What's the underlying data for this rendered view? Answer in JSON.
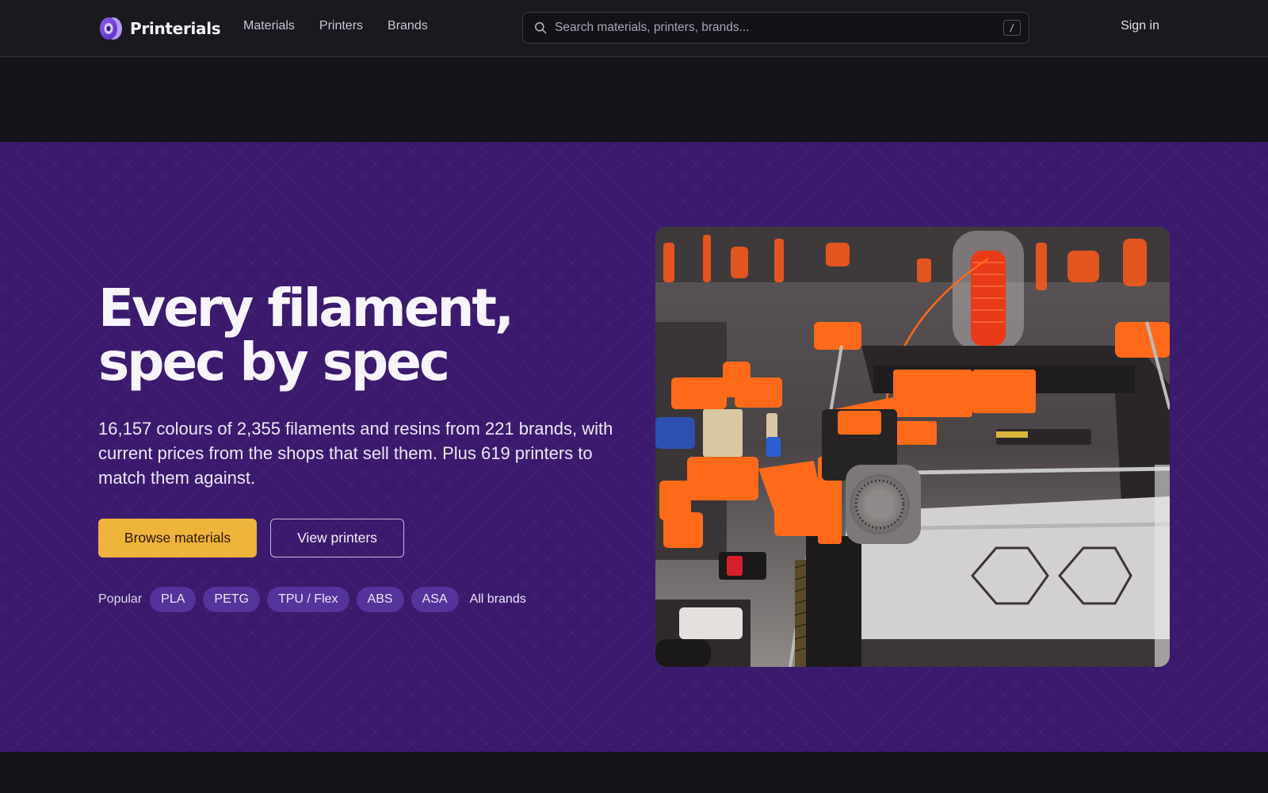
{
  "brand": {
    "name": "Printerials"
  },
  "nav": {
    "items": [
      {
        "label": "Materials"
      },
      {
        "label": "Printers"
      },
      {
        "label": "Brands"
      }
    ]
  },
  "search": {
    "placeholder": "Search materials, printers, brands...",
    "shortcut": "/"
  },
  "header": {
    "signin_label": "Sign in"
  },
  "hero": {
    "title_line1": "Every filament,",
    "title_line2": "spec by spec",
    "description": "16,157 colours of 2,355 filaments and resins from 221 brands, with current prices from the shops that sell them. Plus 619 printers to match them against.",
    "primary_button": "Browse materials",
    "secondary_button": "View printers",
    "popular_label": "Popular",
    "popular_chips": [
      {
        "label": "PLA"
      },
      {
        "label": "PETG"
      },
      {
        "label": "TPU / Flex"
      },
      {
        "label": "ABS"
      },
      {
        "label": "ASA"
      }
    ],
    "all_brands_label": "All brands"
  },
  "colors": {
    "hero_bg": "#3b1a6e",
    "accent": "#efb43c",
    "chip_bg": "#54339a",
    "page_bg": "#15141b",
    "printed_parts": "#ff6a1a"
  }
}
